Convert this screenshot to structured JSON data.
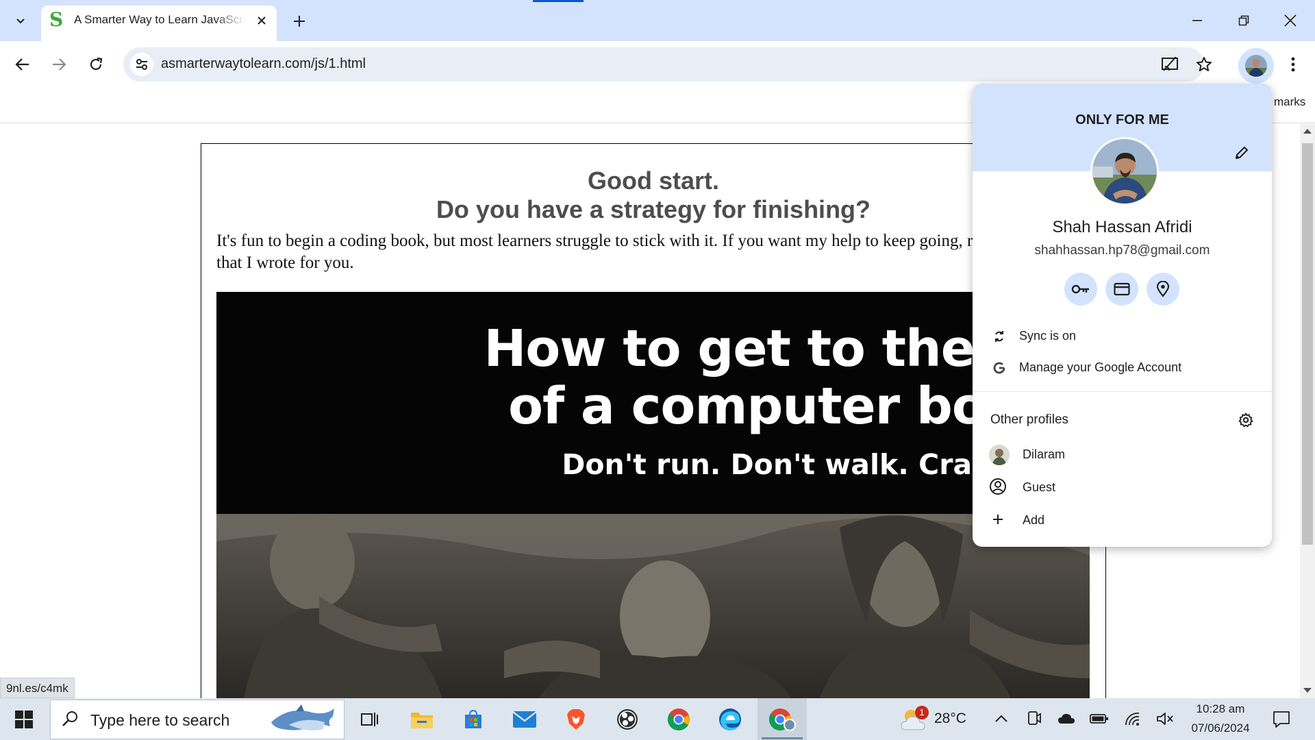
{
  "browser": {
    "tab": {
      "title": "A Smarter Way to Learn JavaScript",
      "favicon_letter": "S"
    },
    "address_bar": {
      "url": "asmarterwaytolearn.com/js/1.html"
    },
    "bookmarks_bar": {
      "partial_text": "marks"
    },
    "status_url": "9nl.es/c4mk"
  },
  "page": {
    "heading_line1": "Good start.",
    "heading_line2": "Do you have a strategy for finishing?",
    "intro": "It's fun to begin a coding book, but most learners struggle to stick with it. If you want my help to keep going, read this essay that I wrote for you.",
    "promo": {
      "title_line1": "How to get to the end",
      "title_line2": "of a computer book.",
      "subtitle": "Don't run. Don't walk. Crawl."
    }
  },
  "profile_popup": {
    "header_label": "ONLY FOR ME",
    "name": "Shah Hassan Afridi",
    "email": "shahhassan.hp78@gmail.com",
    "sync_label": "Sync is on",
    "manage_label": "Manage your Google Account",
    "other_profiles_title": "Other profiles",
    "profiles": [
      {
        "label": "Dilaram"
      },
      {
        "label": "Guest"
      },
      {
        "label": "Add"
      }
    ]
  },
  "taskbar": {
    "search_placeholder": "Type here to search",
    "weather": {
      "temperature": "28°C",
      "badge": "1"
    },
    "clock": {
      "time": "10:28 am",
      "date": "07/06/2024"
    }
  },
  "colors": {
    "tabstrip": "#d3e3fd",
    "omnibox": "#e9eef6",
    "accent": "#0b57d0",
    "taskbar": "#dde6ee"
  }
}
